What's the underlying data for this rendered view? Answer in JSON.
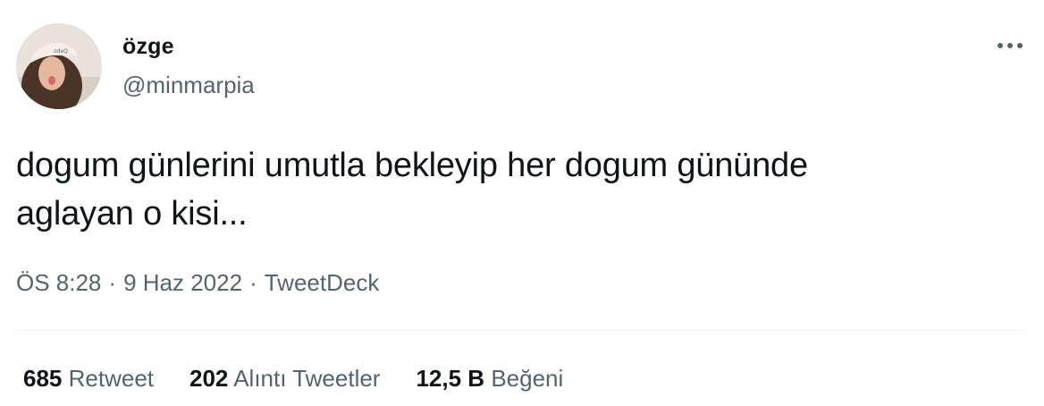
{
  "author": {
    "name": "özge",
    "handle": "@minmarpia"
  },
  "tweet": {
    "text_lines": [
      "dogum günlerini umutla bekleyip her dogum gününde",
      "aglayan o kisi..."
    ],
    "time": "ÖS 8:28",
    "date": "9 Haz 2022",
    "source": "TweetDeck",
    "separator": "·"
  },
  "stats": {
    "retweets": {
      "count": "685",
      "label": "Retweet"
    },
    "quotes": {
      "count": "202",
      "label": "Alıntı Tweetler"
    },
    "likes": {
      "count": "12,5 B",
      "label": "Beğeni"
    }
  },
  "icons": {
    "more": "more-horizontal-icon"
  },
  "colors": {
    "text_primary": "#0f1419",
    "text_secondary": "#536471",
    "divider": "#eff3f4"
  }
}
